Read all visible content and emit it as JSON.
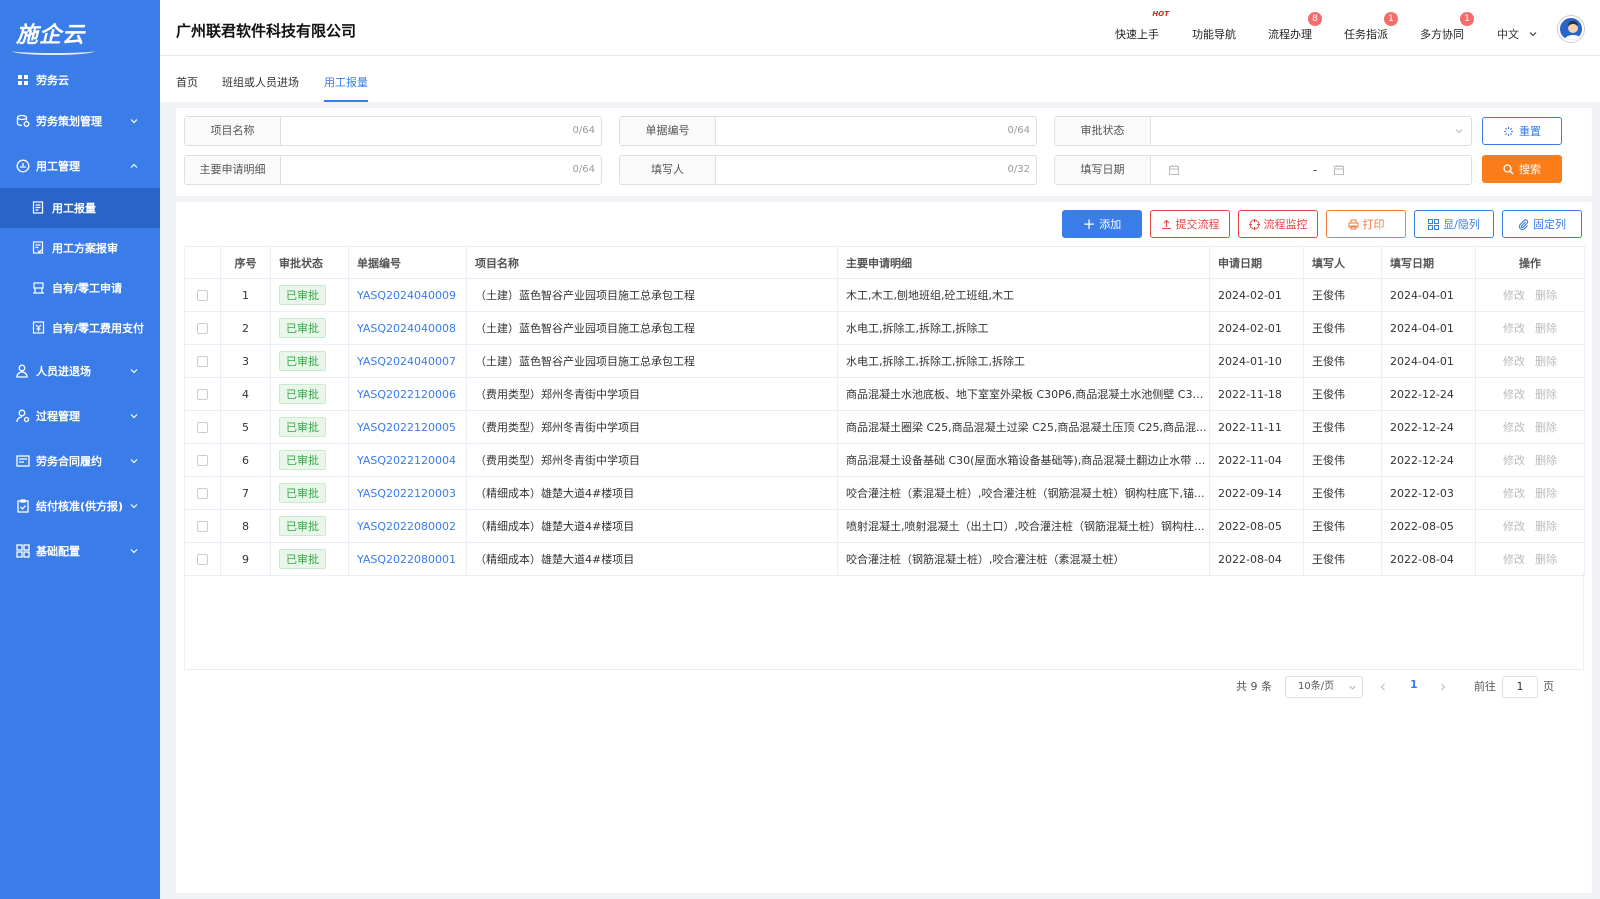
{
  "app": {
    "logo": "施企云",
    "company": "广州联君软件科技有限公司"
  },
  "header": {
    "quick_start": "快速上手",
    "hot_label": "HOT",
    "function_nav": "功能导航",
    "process_handle": "流程办理",
    "process_badge": "8",
    "task_assign": "任务指派",
    "task_badge": "1",
    "multi_collab": "多方协同",
    "collab_badge": "1",
    "language": "中文"
  },
  "sidebar": {
    "labor_cloud": "劳务云",
    "labor_plan": "劳务策划管理",
    "labor_manage": "用工管理",
    "sub_report": "用工报量",
    "sub_plan": "用工方案报审",
    "sub_apply": "自有/零工申请",
    "sub_pay": "自有/零工费用支付",
    "personnel": "人员进退场",
    "process": "过程管理",
    "contract": "劳务合同履约",
    "settlement": "结付核准(供方报)",
    "base_config": "基础配置"
  },
  "tabs": {
    "home": "首页",
    "team": "班组或人员进场",
    "report": "用工报量"
  },
  "filter": {
    "project_name": "项目名称",
    "project_count": "0/64",
    "doc_no": "单据编号",
    "doc_count": "0/64",
    "approval_status": "审批状态",
    "main_detail": "主要申请明细",
    "detail_count": "0/64",
    "filler": "填写人",
    "filler_count": "0/32",
    "fill_date": "填写日期",
    "date_sep": "-",
    "reset": "重置",
    "search": "搜索"
  },
  "toolbar": {
    "add": "添加",
    "submit": "提交流程",
    "monitor": "流程监控",
    "print": "打印",
    "toggle_cols": "显/隐列",
    "fix_cols": "固定列"
  },
  "table": {
    "headers": [
      "序号",
      "审批状态",
      "单据编号",
      "项目名称",
      "主要申请明细",
      "申请日期",
      "填写人",
      "填写日期",
      "操作"
    ],
    "edit": "修改",
    "delete": "删除",
    "rows": [
      {
        "no": "1",
        "status": "已审批",
        "code": "YASQ2024040009",
        "project": "（土建）蓝色智谷产业园项目施工总承包工程",
        "detail": "木工,木工,刨地班组,砼工班组,木工",
        "apply_date": "2024-02-01",
        "filler": "王俊伟",
        "fill_date": "2024-04-01"
      },
      {
        "no": "2",
        "status": "已审批",
        "code": "YASQ2024040008",
        "project": "（土建）蓝色智谷产业园项目施工总承包工程",
        "detail": "水电工,拆除工,拆除工,拆除工",
        "apply_date": "2024-02-01",
        "filler": "王俊伟",
        "fill_date": "2024-04-01"
      },
      {
        "no": "3",
        "status": "已审批",
        "code": "YASQ2024040007",
        "project": "（土建）蓝色智谷产业园项目施工总承包工程",
        "detail": "水电工,拆除工,拆除工,拆除工,拆除工",
        "apply_date": "2024-01-10",
        "filler": "王俊伟",
        "fill_date": "2024-04-01"
      },
      {
        "no": "4",
        "status": "已审批",
        "code": "YASQ2022120006",
        "project": "（费用类型）郑州冬青街中学项目",
        "detail": "商品混凝土水池底板、地下室室外梁板 C30P6,商品混凝土水池侧壁 C30...",
        "apply_date": "2022-11-18",
        "filler": "王俊伟",
        "fill_date": "2022-12-24"
      },
      {
        "no": "5",
        "status": "已审批",
        "code": "YASQ2022120005",
        "project": "（费用类型）郑州冬青街中学项目",
        "detail": "商品混凝土圈梁 C25,商品混凝土过梁 C25,商品混凝土压顶 C25,商品混...",
        "apply_date": "2022-11-11",
        "filler": "王俊伟",
        "fill_date": "2022-12-24"
      },
      {
        "no": "6",
        "status": "已审批",
        "code": "YASQ2022120004",
        "project": "（费用类型）郑州冬青街中学项目",
        "detail": "商品混凝土设备基础 C30(屋面水箱设备基础等),商品混凝土翻边止水带 ...",
        "apply_date": "2022-11-04",
        "filler": "王俊伟",
        "fill_date": "2022-12-24"
      },
      {
        "no": "7",
        "status": "已审批",
        "code": "YASQ2022120003",
        "project": "（精细成本）雄楚大道4#楼项目",
        "detail": "咬合灌注桩（素混凝土桩）,咬合灌注桩（钢筋混凝土桩）钢构柱底下,锚...",
        "apply_date": "2022-09-14",
        "filler": "王俊伟",
        "fill_date": "2022-12-03"
      },
      {
        "no": "8",
        "status": "已审批",
        "code": "YASQ2022080002",
        "project": "（精细成本）雄楚大道4#楼项目",
        "detail": "喷射混凝土,喷射混凝土（出土口）,咬合灌注桩（钢筋混凝土桩）钢构柱...",
        "apply_date": "2022-08-05",
        "filler": "王俊伟",
        "fill_date": "2022-08-05"
      },
      {
        "no": "9",
        "status": "已审批",
        "code": "YASQ2022080001",
        "project": "（精细成本）雄楚大道4#楼项目",
        "detail": "咬合灌注桩（钢筋混凝土桩）,咬合灌注桩（素混凝土桩）",
        "apply_date": "2022-08-04",
        "filler": "王俊伟",
        "fill_date": "2022-08-04"
      }
    ]
  },
  "pagination": {
    "total": "共 9 条",
    "page_size": "10条/页",
    "current": "1",
    "goto": "前往",
    "page_input": "1",
    "page_unit": "页"
  },
  "colors": {
    "sidebar": "#3a7ce8",
    "accent": "#3a7ce8",
    "search": "#fa7d1a",
    "danger": "#e64545",
    "approved": "#3aa64a"
  }
}
